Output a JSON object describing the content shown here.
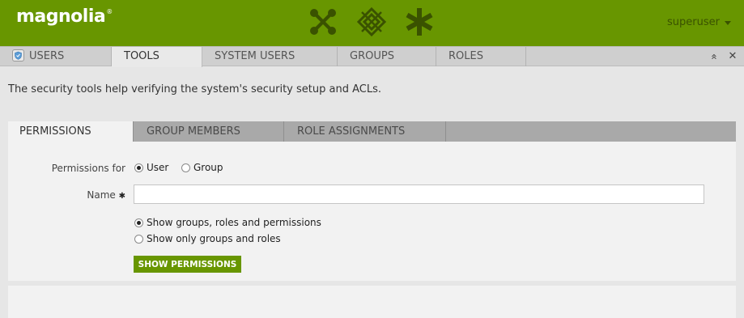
{
  "header": {
    "logo_text": "magnolia",
    "logo_mark": "®",
    "app_icons": [
      "apps-x-icon",
      "diamond-grid-icon",
      "asterisk-icon"
    ],
    "user_name": "superuser",
    "colors": {
      "header_bg": "#689600",
      "icon_color": "#3a5200"
    }
  },
  "app_tabs": [
    {
      "label": "USERS",
      "icon": "shield-icon",
      "active": false
    },
    {
      "label": "TOOLS",
      "active": true
    },
    {
      "label": "SYSTEM USERS",
      "active": false
    },
    {
      "label": "GROUPS",
      "active": false
    },
    {
      "label": "ROLES",
      "active": false
    }
  ],
  "tab_controls": {
    "maximize": "«",
    "close": "✕"
  },
  "main": {
    "description": "The security tools help verifying the system's security setup and ACLs.",
    "sub_tabs": [
      {
        "label": "PERMISSIONS",
        "active": true
      },
      {
        "label": "GROUP MEMBERS",
        "active": false
      },
      {
        "label": "ROLE ASSIGNMENTS",
        "active": false
      }
    ],
    "form": {
      "permissions_for_label": "Permissions for",
      "permissions_for_options": [
        {
          "label": "User",
          "selected": true
        },
        {
          "label": "Group",
          "selected": false
        }
      ],
      "name_label": "Name",
      "name_required_mark": "✱",
      "name_value": "",
      "display_options": [
        {
          "label": "Show groups, roles and permissions",
          "selected": true
        },
        {
          "label": "Show only groups and roles",
          "selected": false
        }
      ],
      "submit_label": "SHOW PERMISSIONS"
    }
  }
}
